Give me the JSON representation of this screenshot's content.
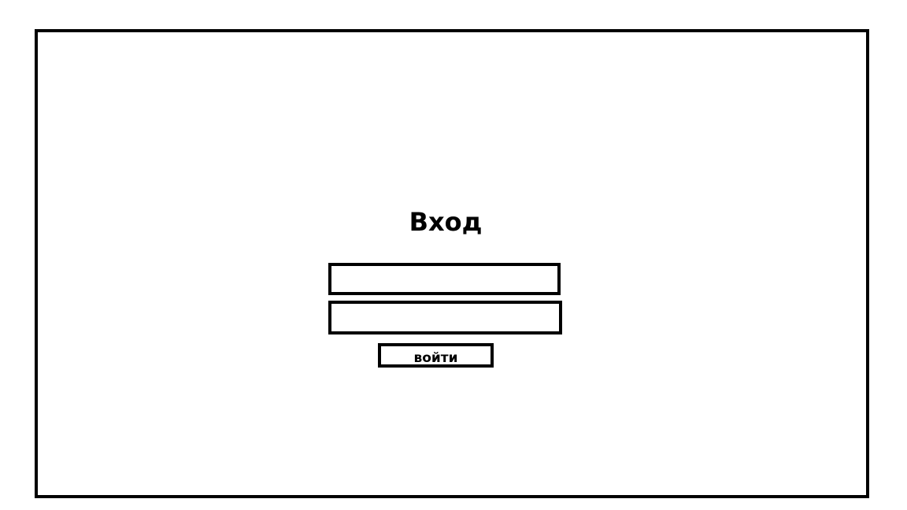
{
  "login_form": {
    "title": "Вход",
    "login_field": {
      "value": "",
      "placeholder": ""
    },
    "password_field": {
      "value": "",
      "placeholder": ""
    },
    "submit_label": "войти"
  }
}
